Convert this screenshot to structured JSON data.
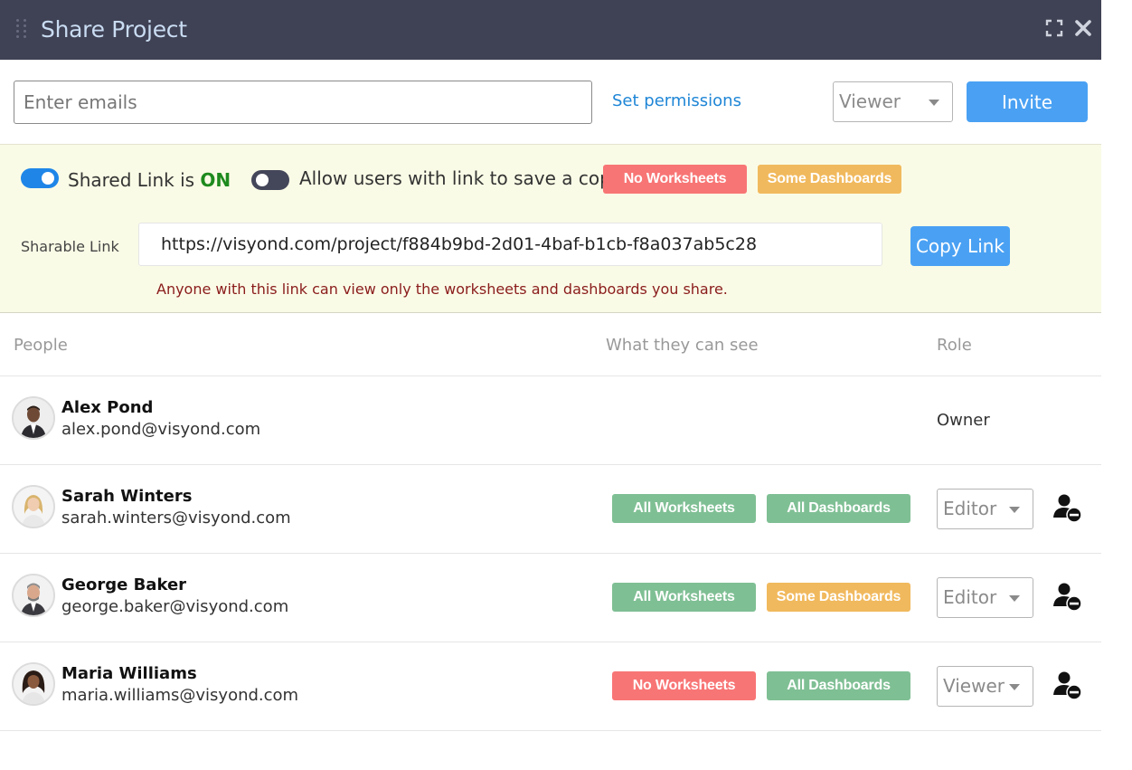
{
  "header": {
    "title": "Share Project",
    "icons": [
      "drag-handle-icon",
      "expand-icon",
      "close-icon"
    ],
    "background": "#3f4154"
  },
  "invite": {
    "email_placeholder": "Enter emails",
    "email_value": "",
    "set_permissions_label": "Set permissions",
    "role_selected": "Viewer",
    "invite_label": "Invite"
  },
  "shared_link": {
    "toggle_label_prefix": "Shared Link is ",
    "toggle_state_word": "ON",
    "toggle_on": true,
    "allow_save_label": "Allow users with link to save a copy",
    "allow_save_on": false,
    "worksheets_badge": "No Worksheets",
    "dashboards_badge": "Some Dashboards",
    "sharable_label": "Sharable Link",
    "url": "https://visyond.com/project/f884b9bd-2d01-4baf-b1cb-f8a037ab5c28",
    "copy_label": "Copy Link",
    "note": "Anyone with this link can view only the worksheets and dashboards you share."
  },
  "table": {
    "headers": {
      "people": "People",
      "visibility": "What they can see",
      "role": "Role"
    },
    "rows": [
      {
        "name": "Alex Pond",
        "email": "alex.pond@visyond.com",
        "role": "Owner"
      },
      {
        "name": "Sarah Winters",
        "email": "sarah.winters@visyond.com",
        "worksheets": "All Worksheets",
        "dashboards": "All Dashboards",
        "role": "Editor"
      },
      {
        "name": "George Baker",
        "email": "george.baker@visyond.com",
        "worksheets": "All Worksheets",
        "dashboards": "Some Dashboards",
        "role": "Editor"
      },
      {
        "name": "Maria Williams",
        "email": "maria.williams@visyond.com",
        "worksheets": "No Worksheets",
        "dashboards": "All Dashboards",
        "role": "Viewer"
      }
    ]
  },
  "colors": {
    "accent_blue": "#4aa1f3",
    "badge_red": "#f87575",
    "badge_orange": "#f1b95d",
    "badge_green": "#7fbf94",
    "panel_bg": "#fafbe6",
    "on_green": "#1e8a1e"
  }
}
